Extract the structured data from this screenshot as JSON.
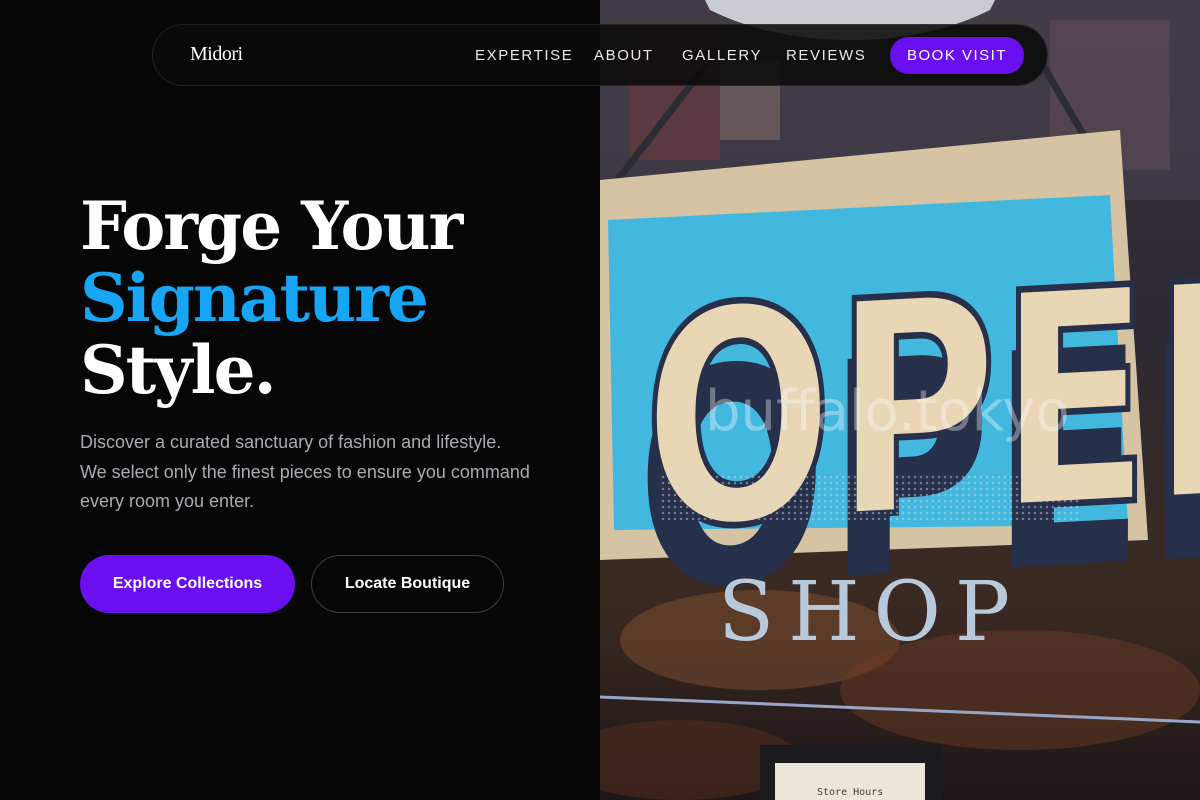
{
  "brand": "Midori",
  "nav": {
    "links": [
      "EXPERTISE",
      "ABOUT",
      "GALLERY",
      "REVIEWS"
    ],
    "cta": "BOOK VISIT"
  },
  "hero": {
    "line1": "Forge Your",
    "line2": "Signature",
    "line3": "Style.",
    "description": "Discover a curated sanctuary of fashion and lifestyle. We select only the finest pieces to ensure you command every room you enter.",
    "primary_button": "Explore Collections",
    "secondary_button": "Locate Boutique"
  },
  "image": {
    "sign_text": "OPEN",
    "shop_text": "SHOP",
    "watermark": "buffalo.tokyo",
    "hours_label": "Store Hours"
  },
  "colors": {
    "accent": "#16a6f5",
    "brand_purple": "#6a0ff0",
    "background": "#070707"
  }
}
